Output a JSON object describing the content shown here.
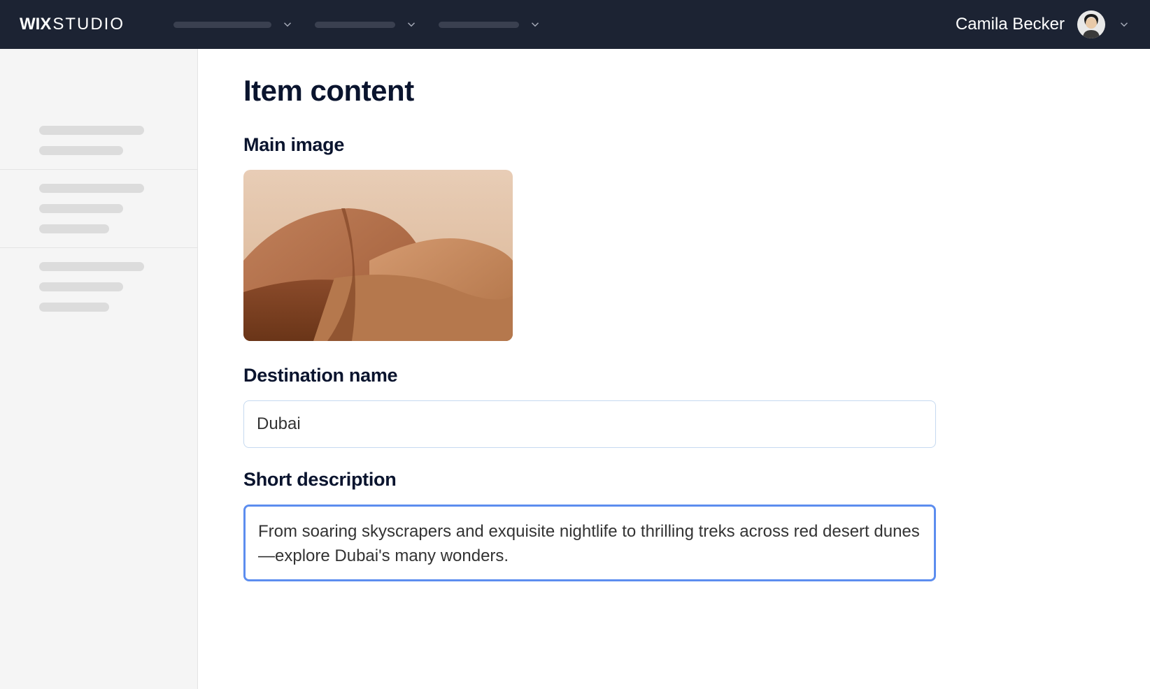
{
  "header": {
    "logo_wix": "WIX",
    "logo_studio": "STUDIO",
    "user_name": "Camila Becker"
  },
  "main": {
    "page_title": "Item content",
    "main_image_label": "Main image",
    "destination_name_label": "Destination name",
    "destination_name_value": "Dubai",
    "short_description_label": "Short description",
    "short_description_value": "From soaring skyscrapers and exquisite nightlife to thrilling treks across red desert dunes—explore Dubai's many wonders."
  }
}
